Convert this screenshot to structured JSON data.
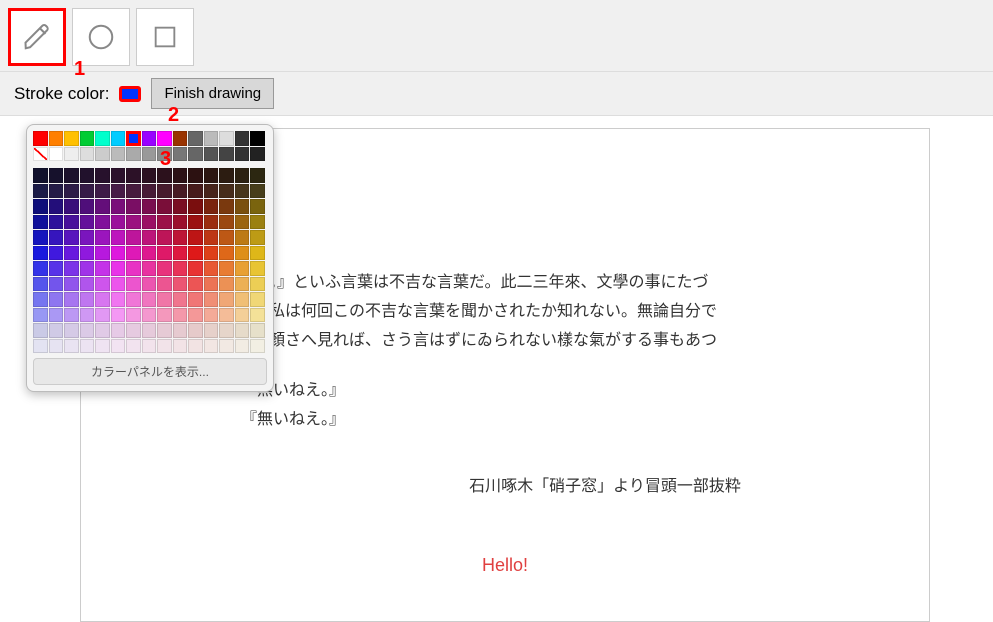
{
  "toolbar": {
    "tools": [
      "pencil",
      "circle",
      "square"
    ],
    "selected": "pencil"
  },
  "subtoolbar": {
    "stroke_label": "Stroke color:",
    "current_color": "#0033ff",
    "finish_label": "Finish drawing"
  },
  "annotations": {
    "one": "1",
    "two": "2",
    "three": "3"
  },
  "color_panel": {
    "row1": [
      "#ff0000",
      "#ff7f00",
      "#ffc000",
      "#00cc33",
      "#00ffcc",
      "#00ccff",
      "#0033ff",
      "#9900ff",
      "#ff00ff",
      "#993300",
      "#666666",
      "#bbbbbb",
      "#dddddd",
      "#333333",
      "#000000"
    ],
    "row2": [
      "none",
      "#ffffff",
      "#eeeeee",
      "#dddddd",
      "#cccccc",
      "#bbbbbb",
      "#aaaaaa",
      "#999999",
      "#888888",
      "#777777",
      "#666666",
      "#555555",
      "#444444",
      "#333333",
      "#222222"
    ],
    "grid_meta": {
      "cols": 15,
      "rows": 12
    },
    "selected_swatch": "#0033ff",
    "show_label": "カラーパネルを表示..."
  },
  "document": {
    "lines": [
      "い事は無いかねえ。』といふ言葉は不吉な言葉だ。此二三年來、文學の事にたづ",
      "る若い人達から、私は何回この不吉な言葉を聞かされたか知れない。無論自分で",
      "――或時は、人の顏さへ見れば、さう言はずにゐられない樣な氣がする事もあつ",
      "",
      "『無いねえ。』",
      "『無いねえ。』"
    ],
    "attribution": "石川啄木「硝子窓」より冒頭一部抜粋",
    "hello": "Hello!"
  }
}
